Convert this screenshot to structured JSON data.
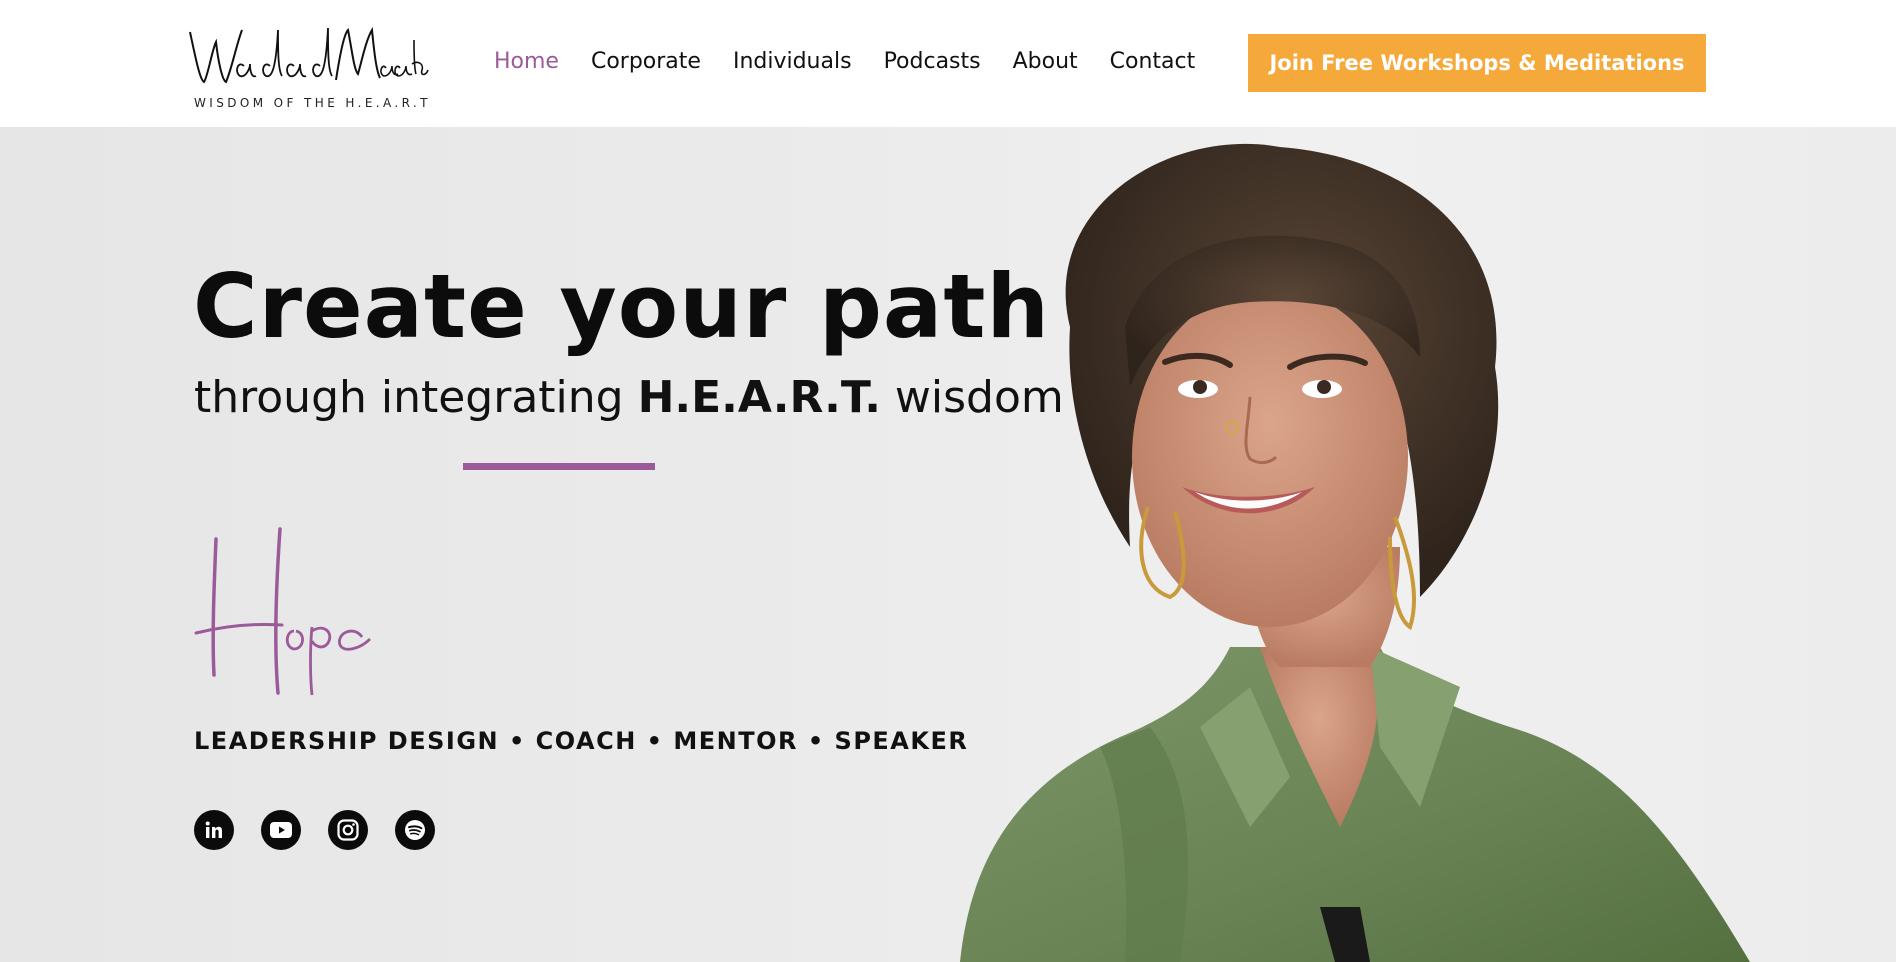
{
  "brand": {
    "logo_name": "WadadMaalouf",
    "tagline": "WISDOM OF THE H.E.A.R.T"
  },
  "nav": {
    "items": [
      {
        "label": "Home",
        "active": true
      },
      {
        "label": "Corporate",
        "active": false
      },
      {
        "label": "Individuals",
        "active": false
      },
      {
        "label": "Podcasts",
        "active": false
      },
      {
        "label": "About",
        "active": false
      },
      {
        "label": "Contact",
        "active": false
      }
    ],
    "cta_label": "Join Free Workshops & Meditations"
  },
  "hero": {
    "headline": "Create your path",
    "subline_pre": "through integrating ",
    "subline_bold": "H.E.A.R.T.",
    "subline_post": " wisdom",
    "script_word": "Hope",
    "roles": "LEADERSHIP DESIGN • COACH • MENTOR • SPEAKER"
  },
  "socials": [
    {
      "icon": "linkedin-icon"
    },
    {
      "icon": "youtube-icon"
    },
    {
      "icon": "instagram-icon"
    },
    {
      "icon": "spotify-icon"
    }
  ],
  "colors": {
    "accent_purple": "#9b5a9a",
    "cta_orange": "#f6a93b",
    "text_dark": "#111111",
    "hero_bg": "#ebebeb",
    "shirt_green": "#6f8a5c"
  }
}
